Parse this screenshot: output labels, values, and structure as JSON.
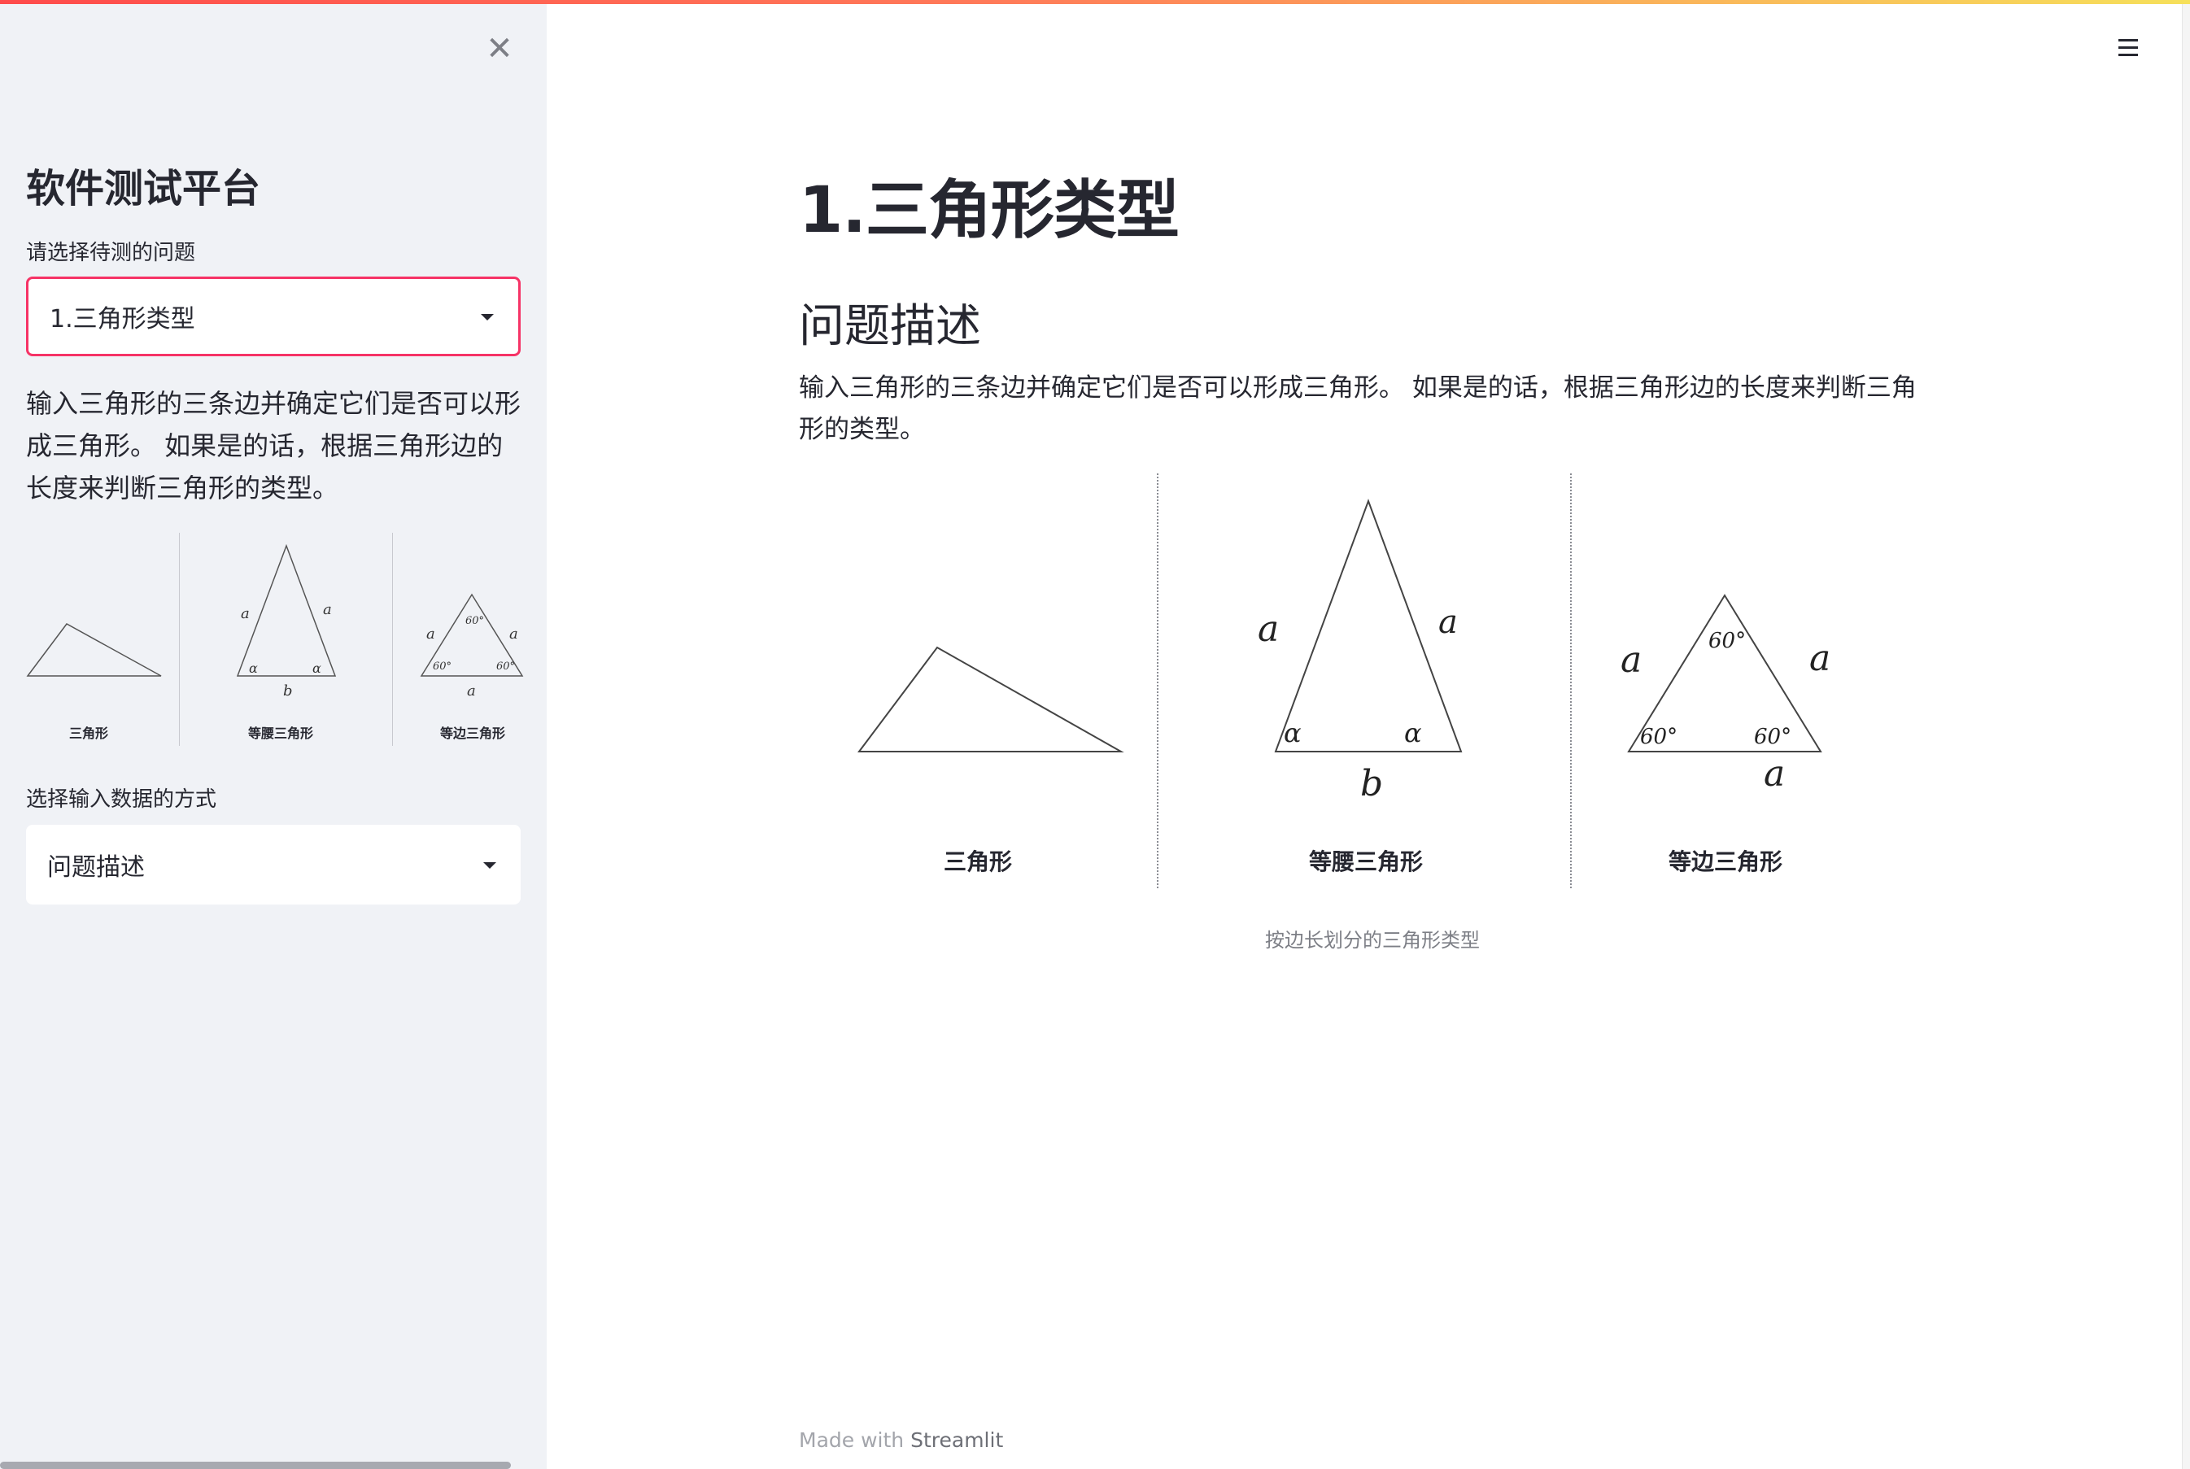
{
  "sidebar": {
    "close_icon": "close-icon",
    "title": "软件测试平台",
    "problem_label": "请选择待测的问题",
    "problem_selected": "1.三角形类型",
    "description": "输入三角形的三条边并确定它们是否可以形成三角形。 如果是的话，根据三角形边的长度来判断三角形的类型。",
    "thumbs": [
      {
        "caption": "三角形"
      },
      {
        "caption": "等腰三角形"
      },
      {
        "caption": "等边三角形"
      }
    ],
    "input_method_label": "选择输入数据的方式",
    "input_method_selected": "问题描述",
    "accent_color": "#f63366"
  },
  "header": {
    "menu_icon": "hamburger-menu-icon",
    "gradient_colors": [
      "#ff4b4b",
      "#f6e05a"
    ]
  },
  "main": {
    "title": "1.三角形类型",
    "section_heading": "问题描述",
    "description": "输入三角形的三条边并确定它们是否可以形成三角形。 如果是的话，根据三角形边的长度来判断三角形的类型。",
    "figure": {
      "panels": [
        {
          "caption": "三角形",
          "labels": []
        },
        {
          "caption": "等腰三角形",
          "labels": [
            "a",
            "a",
            "α",
            "α",
            "b"
          ]
        },
        {
          "caption": "等边三角形",
          "labels": [
            "a",
            "a",
            "a",
            "60°",
            "60°",
            "60°"
          ]
        }
      ],
      "caption": "按边长划分的三角形类型"
    }
  },
  "footer": {
    "made_with": "Made with",
    "brand": "Streamlit"
  }
}
